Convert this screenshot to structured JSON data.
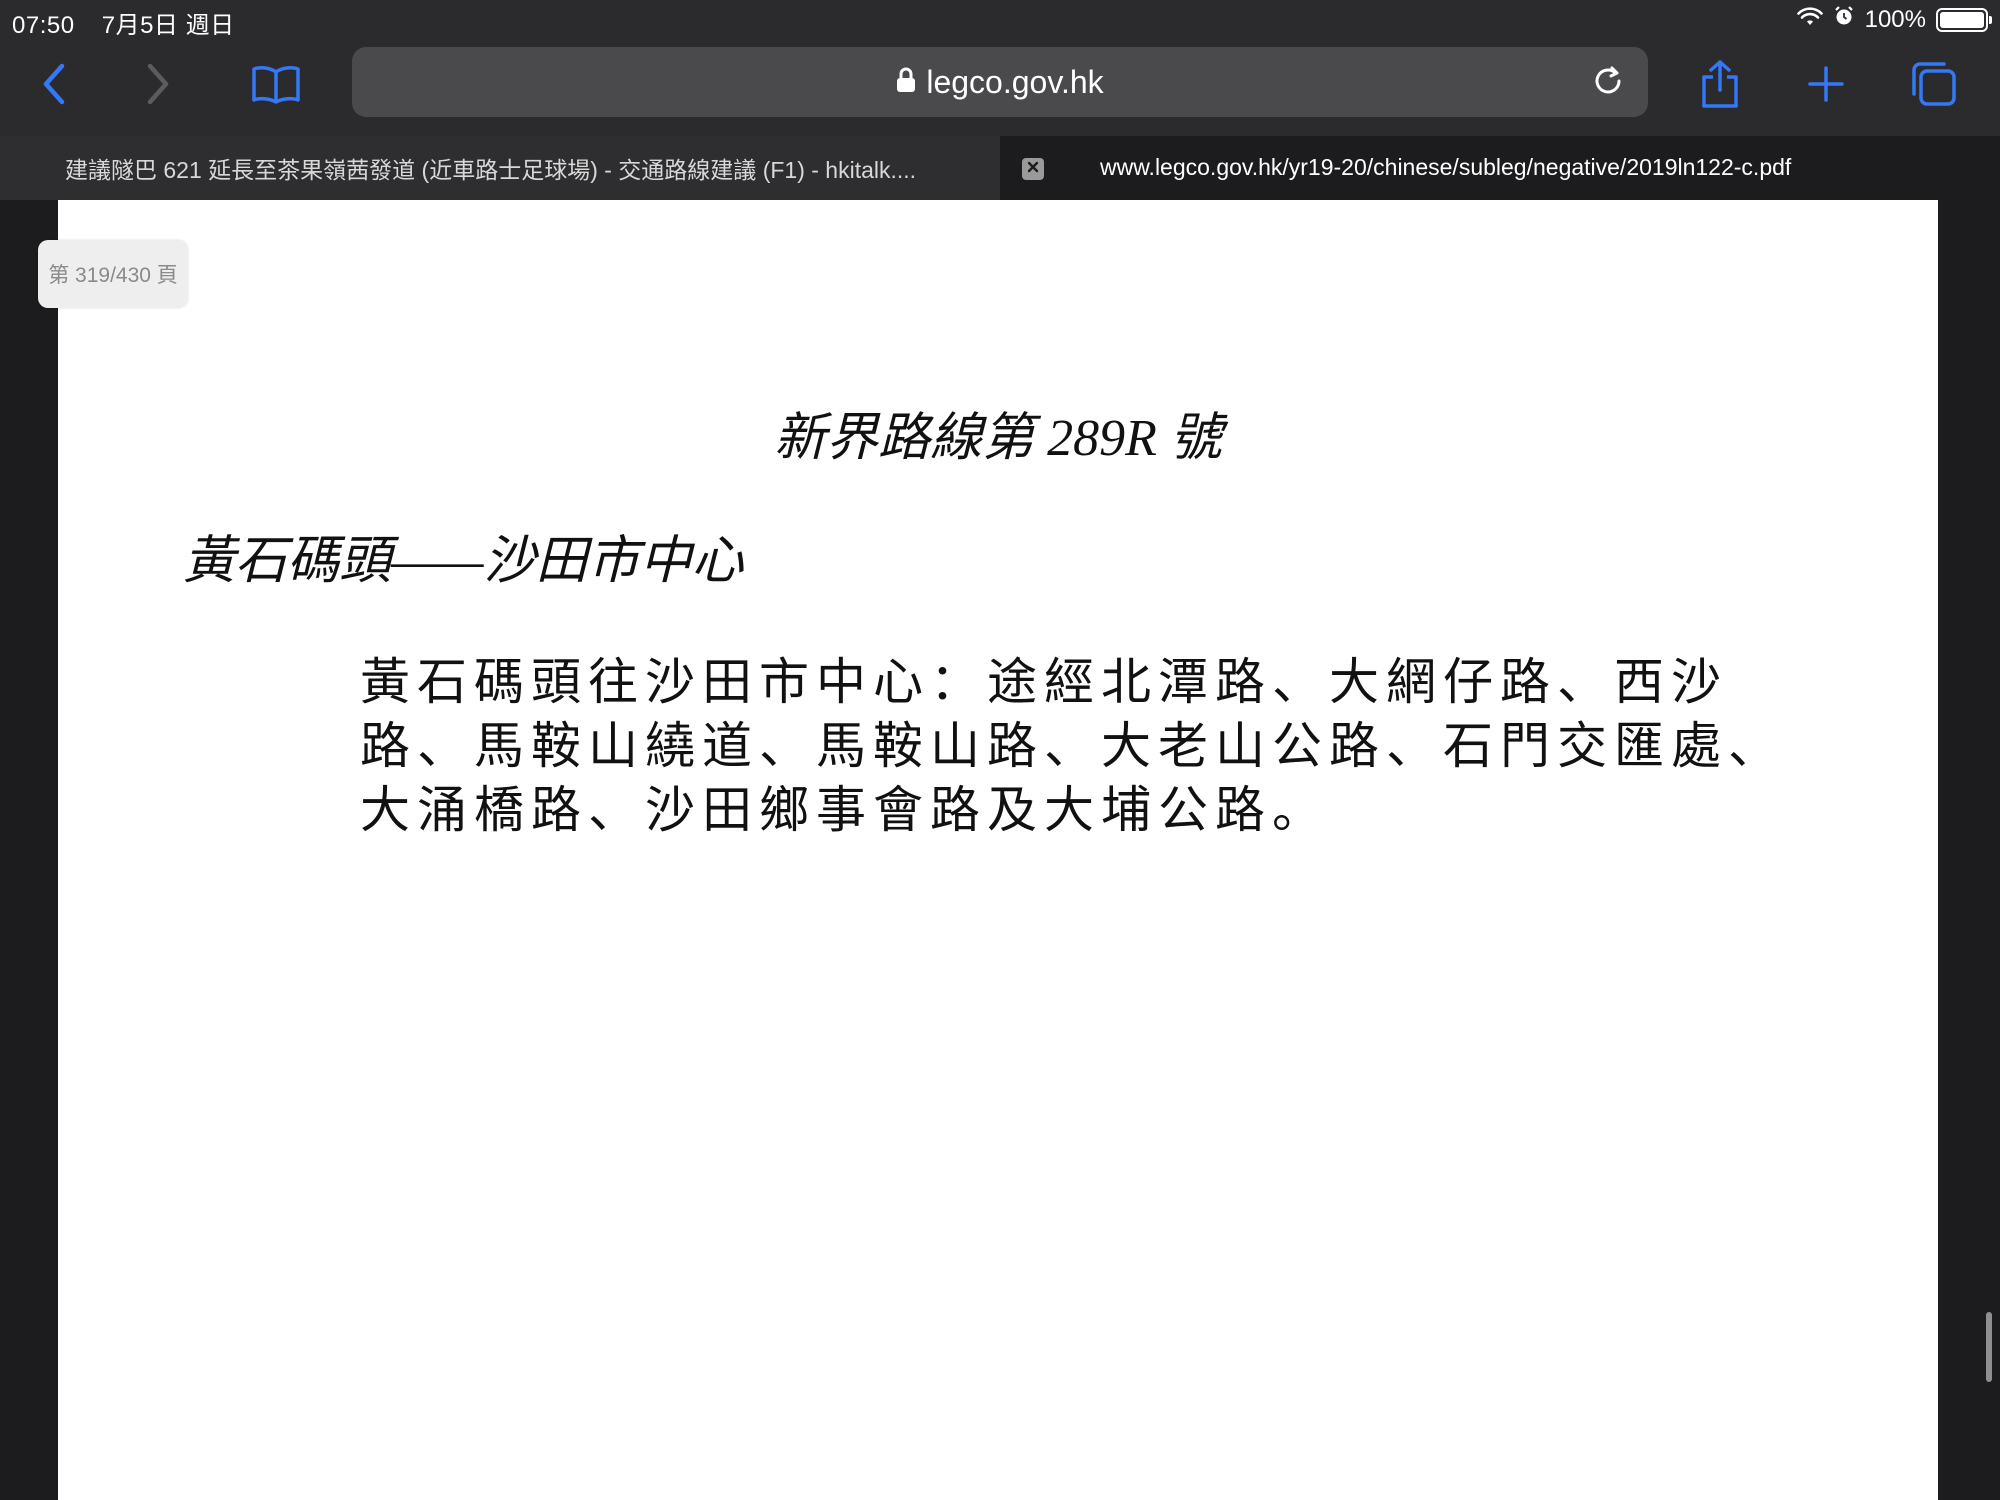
{
  "status_bar": {
    "time": "07:50",
    "date": "7月5日 週日",
    "battery": "100%",
    "battery_level": 1.0
  },
  "toolbar": {
    "url": "legco.gov.hk",
    "icons": [
      "back-icon",
      "forward-icon",
      "bookmarks-icon",
      "lock-icon",
      "reload-icon",
      "share-icon",
      "new-tab-icon",
      "tabs-icon"
    ]
  },
  "tabs": [
    {
      "label": "建議隧巴 621 延長至茶果嶺茜發道 (近車路士足球場) - 交通路線建議 (F1) - hkitalk...."
    },
    {
      "label": "www.legco.gov.hk/yr19-20/chinese/subleg/negative/2019ln122-c.pdf"
    }
  ],
  "viewer": {
    "page_indicator": "第 319/430 頁"
  },
  "document": {
    "title": "新界路線第 289R 號",
    "route": "黃石碼頭——沙田市中心",
    "body": "黃石碼頭往沙田市中心：途經北潭路、大網仔路、西沙路、馬鞍山繞道、馬鞍山路、大老山公路、石門交匯處、大涌橋路、沙田鄉事會路及大埔公路。"
  },
  "colors": {
    "accent": "#3478f6",
    "chrome": "#2b2b2e",
    "page": "#ffffff"
  }
}
